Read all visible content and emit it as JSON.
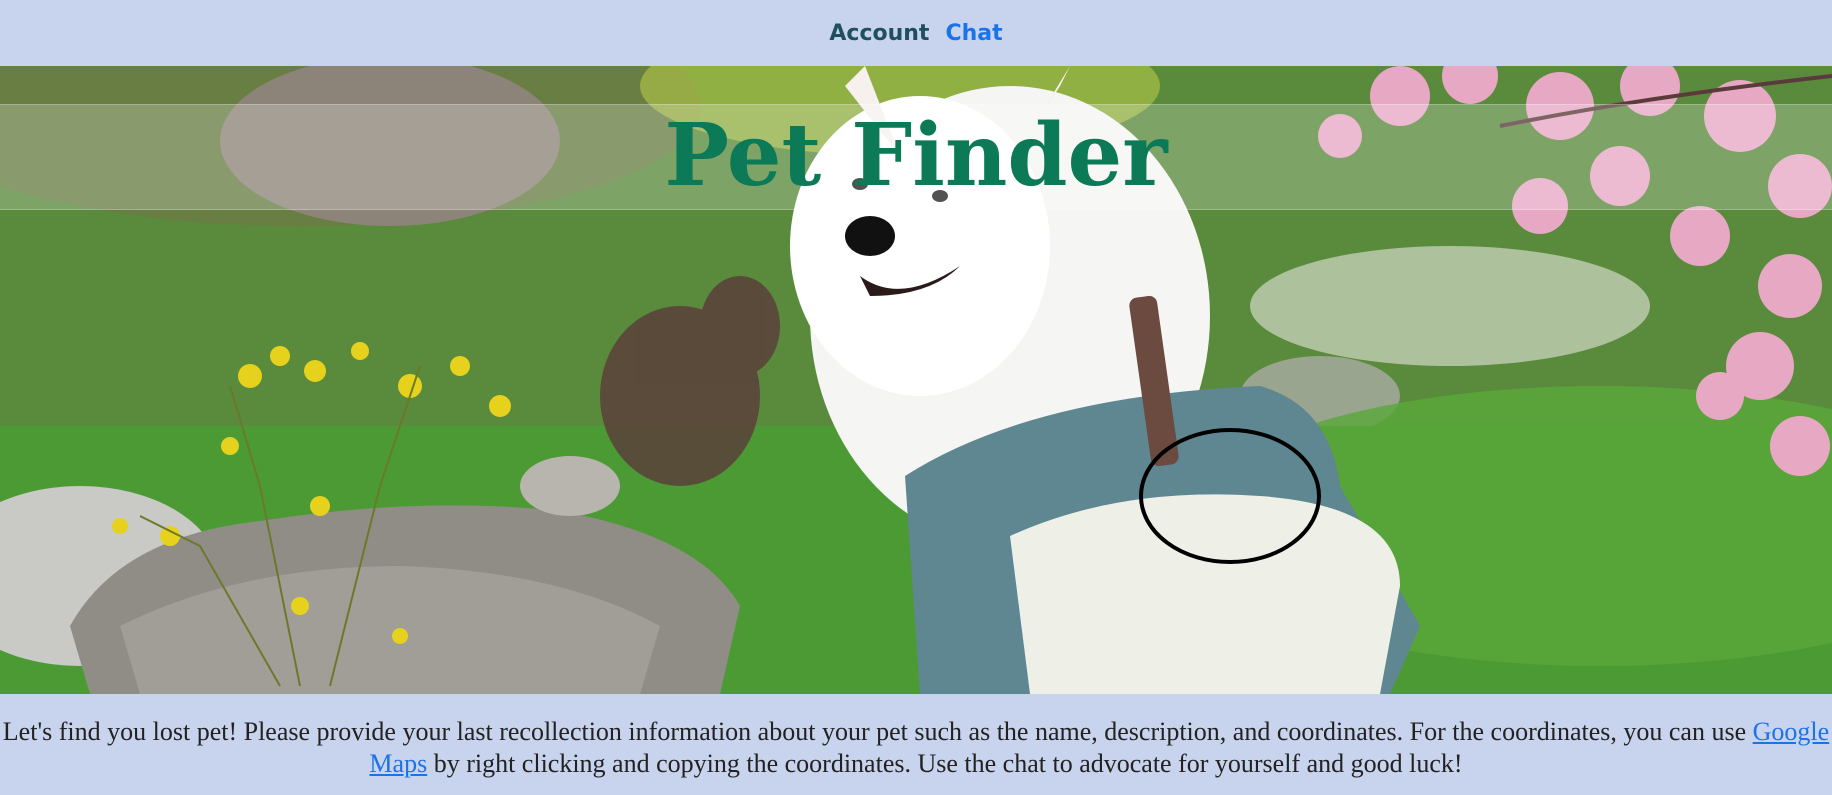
{
  "nav": {
    "account_label": "Account",
    "chat_label": "Chat"
  },
  "hero": {
    "title": "Pet Finder",
    "image": "white-dog-photo"
  },
  "info": {
    "text_before_link": "Let's find you lost pet! Please provide your last recollection information about your pet such as the name, description, and coordinates. For the coordinates, you can use ",
    "link_label": "Google Maps",
    "text_after_link": " by right clicking and copying the coordinates. Use the chat to advocate for yourself and good luck!"
  },
  "colors": {
    "background": "#c8d3ee",
    "title": "#0c7a57",
    "link": "#1a73e8",
    "nav_account": "#1f4e5c"
  }
}
